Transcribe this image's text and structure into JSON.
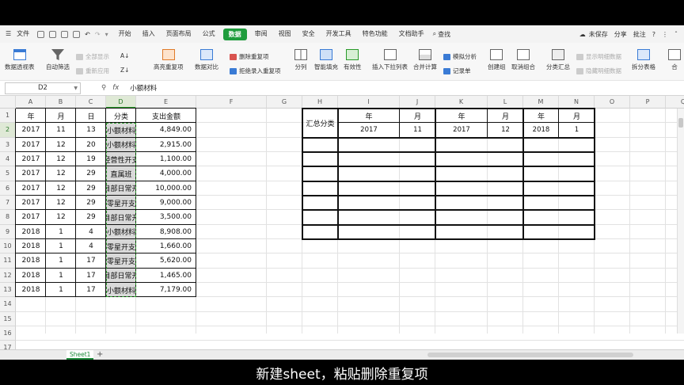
{
  "menubar": {
    "file_label": "文件",
    "tabs": [
      "开始",
      "插入",
      "页面布局",
      "公式",
      "数据",
      "审阅",
      "视图",
      "安全",
      "开发工具",
      "特色功能",
      "文档助手"
    ],
    "active_tab": "数据",
    "search_label": "查找",
    "unsaved_label": "未保存",
    "share_label": "分享",
    "comment_label": "批注"
  },
  "ribbon": {
    "pivot_table": "数据透视表",
    "auto_filter": "自动筛选",
    "show_all": "全部显示",
    "reapply": "重新应用",
    "sort": "排序",
    "highlight_dup": "高亮重复项",
    "data_compare": "数据对比",
    "delete_dup": "删除重复项",
    "reject_dup": "拒绝录入重复项",
    "split_column": "分列",
    "smart_fill": "智能填充",
    "validity": "有效性",
    "insert_dropdown": "插入下拉列表",
    "consolidate": "合并计算",
    "what_if": "模拟分析",
    "record_form": "记录单",
    "create_group": "创建组",
    "ungroup": "取消组合",
    "subtotal": "分类汇总",
    "show_detail": "显示明细数据",
    "hide_detail": "隐藏明细数据",
    "split_table": "拆分表格",
    "merge": "合"
  },
  "formula_bar": {
    "cell_ref": "D2",
    "fx": "fx",
    "content": "小额材料"
  },
  "columns": [
    "A",
    "B",
    "C",
    "D",
    "E",
    "F",
    "G",
    "H",
    "I",
    "J",
    "K",
    "L",
    "M",
    "N",
    "O",
    "P",
    "Q"
  ],
  "rows": [
    "1",
    "2",
    "3",
    "4",
    "5",
    "6",
    "7",
    "8",
    "9",
    "10",
    "11",
    "12",
    "13",
    "14",
    "15",
    "16",
    "17"
  ],
  "data_table": {
    "headers": [
      "年",
      "月",
      "日",
      "分类",
      "支出金额"
    ],
    "rows": [
      [
        "2017",
        "11",
        "13",
        "小额材料",
        "4,849.00"
      ],
      [
        "2017",
        "12",
        "20",
        "小额材料",
        "2,915.00"
      ],
      [
        "2017",
        "12",
        "19",
        "经营性开支",
        "1,100.00"
      ],
      [
        "2017",
        "12",
        "29",
        "直属班",
        "4,000.00"
      ],
      [
        "2017",
        "12",
        "29",
        "项目部日常开支",
        "10,000.00"
      ],
      [
        "2017",
        "12",
        "29",
        "零星开支",
        "9,000.00"
      ],
      [
        "2017",
        "12",
        "29",
        "项目部日常开支",
        "3,500.00"
      ],
      [
        "2018",
        "1",
        "4",
        "小额材料",
        "8,908.00"
      ],
      [
        "2018",
        "1",
        "4",
        "零星开支",
        "1,660.00"
      ],
      [
        "2018",
        "1",
        "17",
        "零星开支",
        "5,620.00"
      ],
      [
        "2018",
        "1",
        "17",
        "项目部日常开支",
        "1,465.00"
      ],
      [
        "2018",
        "1",
        "17",
        "小额材料",
        "7,179.00"
      ]
    ]
  },
  "summary_table": {
    "category_label": "汇总分类",
    "header_row": [
      "年",
      "月",
      "年",
      "月",
      "年",
      "月"
    ],
    "value_row": [
      "2017",
      "11",
      "2017",
      "12",
      "2018",
      "1"
    ]
  },
  "sheet_tab": "Sheet1",
  "add_sheet": "+",
  "caption": "新建sheet，粘贴删除重复项"
}
